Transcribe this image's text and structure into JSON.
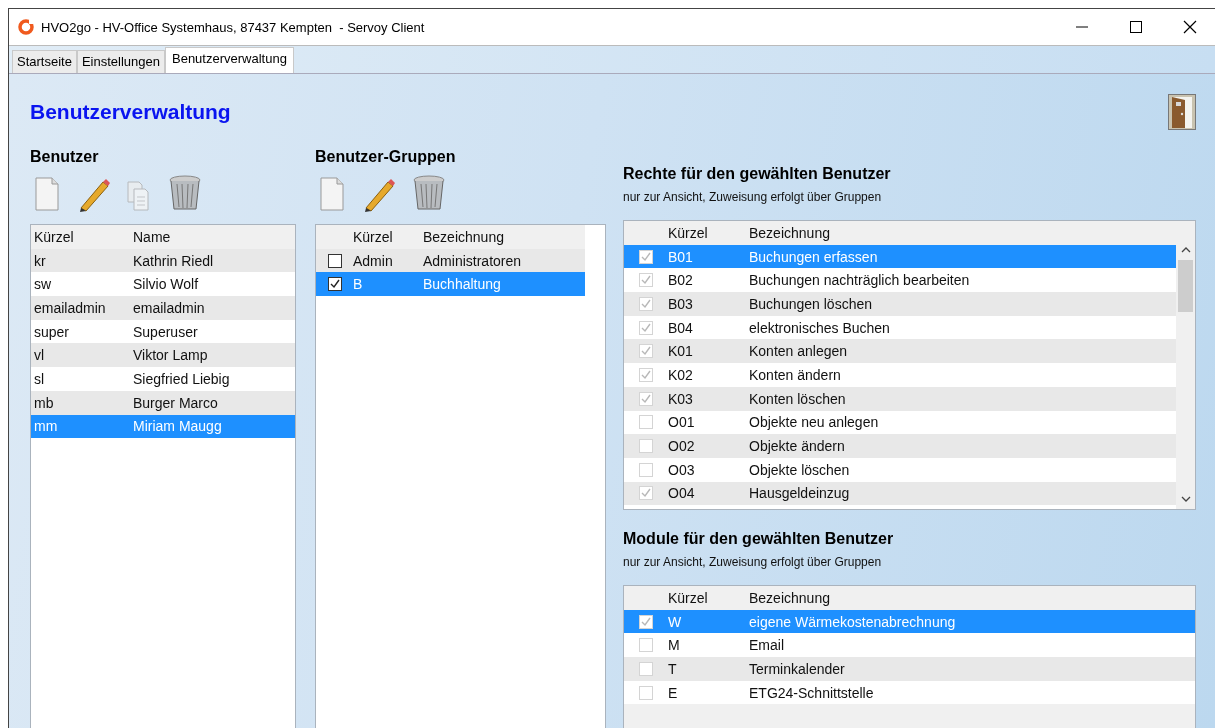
{
  "window": {
    "title": "HVO2go - HV-Office Systemhaus, 87437 Kempten  - Servoy Client"
  },
  "tabs": [
    {
      "label": "Startseite",
      "selected": false
    },
    {
      "label": "Einstellungen",
      "selected": false
    },
    {
      "label": "Benutzerverwaltung",
      "selected": true
    }
  ],
  "page_title": "Benutzerverwaltung",
  "users": {
    "heading": "Benutzer",
    "columns": [
      "Kürzel",
      "Name"
    ],
    "rows": [
      {
        "cells": [
          "kr",
          "Kathrin Riedl"
        ],
        "selected": false
      },
      {
        "cells": [
          "sw",
          "Silvio Wolf"
        ],
        "selected": false
      },
      {
        "cells": [
          "emailadmin",
          "emailadmin"
        ],
        "selected": false
      },
      {
        "cells": [
          "super",
          "Superuser"
        ],
        "selected": false
      },
      {
        "cells": [
          "vl",
          "Viktor Lamp"
        ],
        "selected": false
      },
      {
        "cells": [
          "sl",
          "Siegfried Liebig"
        ],
        "selected": false
      },
      {
        "cells": [
          "mb",
          "Burger Marco"
        ],
        "selected": false
      },
      {
        "cells": [
          "mm",
          "Miriam Maugg"
        ],
        "selected": true
      }
    ]
  },
  "groups": {
    "heading": "Benutzer-Gruppen",
    "disabled": false,
    "columns": [
      "Kürzel",
      "Bezeichnung"
    ],
    "rows": [
      {
        "cells": [
          "Admin",
          "Administratoren"
        ],
        "checked": false,
        "selected": false
      },
      {
        "cells": [
          "B",
          "Buchhaltung"
        ],
        "checked": true,
        "selected": true
      }
    ]
  },
  "rights": {
    "heading": "Rechte für den gewählten Benutzer",
    "note": "nur zur Ansicht, Zuweisung erfolgt über Gruppen",
    "disabled": true,
    "columns": [
      "Kürzel",
      "Bezeichnung"
    ],
    "rows": [
      {
        "cells": [
          "B01",
          "Buchungen erfassen"
        ],
        "checked": true,
        "selected": true
      },
      {
        "cells": [
          "B02",
          "Buchungen nachträglich bearbeiten"
        ],
        "checked": true,
        "selected": false
      },
      {
        "cells": [
          "B03",
          "Buchungen löschen"
        ],
        "checked": true,
        "selected": false
      },
      {
        "cells": [
          "B04",
          "elektronisches Buchen"
        ],
        "checked": true,
        "selected": false
      },
      {
        "cells": [
          "K01",
          "Konten anlegen"
        ],
        "checked": true,
        "selected": false
      },
      {
        "cells": [
          "K02",
          "Konten ändern"
        ],
        "checked": true,
        "selected": false
      },
      {
        "cells": [
          "K03",
          "Konten löschen"
        ],
        "checked": true,
        "selected": false
      },
      {
        "cells": [
          "O01",
          "Objekte neu anlegen"
        ],
        "checked": false,
        "selected": false
      },
      {
        "cells": [
          "O02",
          "Objekte ändern"
        ],
        "checked": false,
        "selected": false
      },
      {
        "cells": [
          "O03",
          "Objekte löschen"
        ],
        "checked": false,
        "selected": false
      },
      {
        "cells": [
          "O04",
          "Hausgeldeinzug"
        ],
        "checked": true,
        "selected": false
      }
    ]
  },
  "modules": {
    "heading": "Module für den gewählten Benutzer",
    "note": "nur zur Ansicht, Zuweisung erfolgt über Gruppen",
    "disabled": true,
    "columns": [
      "Kürzel",
      "Bezeichnung"
    ],
    "rows": [
      {
        "cells": [
          "W",
          "eigene Wärmekostenabrechnung"
        ],
        "checked": true,
        "selected": true
      },
      {
        "cells": [
          "M",
          "Email"
        ],
        "checked": false,
        "selected": false
      },
      {
        "cells": [
          "T",
          "Terminkalender"
        ],
        "checked": false,
        "selected": false
      },
      {
        "cells": [
          "E",
          "ETG24-Schnittstelle"
        ],
        "checked": false,
        "selected": false
      }
    ]
  }
}
